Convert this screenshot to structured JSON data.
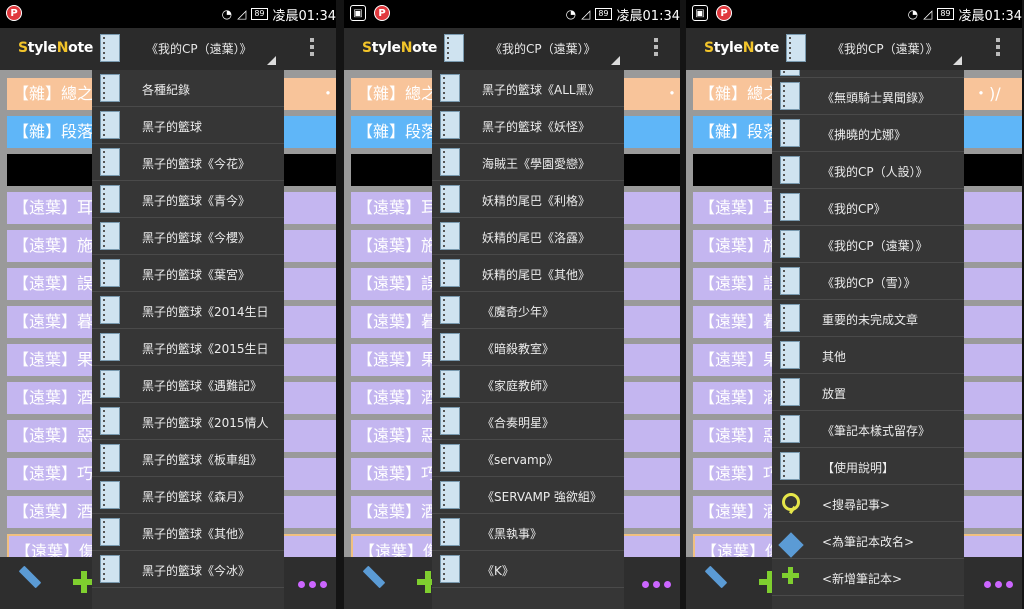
{
  "status_bar": {
    "battery": "89",
    "time": "凌晨01:34"
  },
  "app": {
    "logo_first": "S",
    "logo_mid": "tyle",
    "logo_n": "N",
    "logo_end": "ote",
    "current_notebook": "《我的CP（遠葉）》"
  },
  "colors": {
    "row_orange": "#f8c49a",
    "row_blue": "#5fb6f8",
    "row_black": "#000000",
    "row_purple": "#c4b6f0",
    "accent_green": "#7fcf2f",
    "accent_blue": "#5b9bd5",
    "accent_purple": "#cc66ff",
    "search_yellow": "#e6e64a"
  },
  "icons": [
    "photo-icon",
    "p-app-icon",
    "wifi-icon",
    "signal-icon",
    "battery-icon",
    "notebook-icon",
    "overflow-menu-icon",
    "pen-icon",
    "plus-icon",
    "more-dots-icon",
    "search-icon"
  ],
  "notes": [
    {
      "text": "【雜】總之",
      "suffix": "・)/"
    },
    {
      "text": "【雜】段落"
    },
    {
      "text": ""
    },
    {
      "text": "【遠葉】耳"
    },
    {
      "text": "【遠葉】施"
    },
    {
      "text": "【遠葉】誤"
    },
    {
      "text": "【遠葉】暮"
    },
    {
      "text": "【遠葉】果"
    },
    {
      "text": "【遠葉】酒"
    },
    {
      "text": "【遠葉】惡"
    },
    {
      "text": "【遠葉】巧"
    },
    {
      "text": "【遠葉】酒"
    },
    {
      "text": "【遠葉】傷"
    }
  ],
  "dropdown1": [
    "各種紀錄",
    "黑子的籃球",
    "黑子的籃球《今花》",
    "黑子的籃球《青今》",
    "黑子的籃球《今櫻》",
    "黑子的籃球《葉宮》",
    "黑子的籃球《2014生日",
    "黑子的籃球《2015生日",
    "黑子的籃球《遇難記》",
    "黑子的籃球《2015情人",
    "黑子的籃球《板車組》",
    "黑子的籃球《森月》",
    "黑子的籃球《其他》",
    "黑子的籃球《今冰》"
  ],
  "dropdown2": [
    "黑子的籃球《ALL黑》",
    "黑子的籃球《妖怪》",
    "海賊王《學園愛戀》",
    "妖精的尾巴《利格》",
    "妖精的尾巴《洛露》",
    "妖精的尾巴《其他》",
    "《魔奇少年》",
    "《暗殺教室》",
    "《家庭教師》",
    "《合奏明星》",
    "《servamp》",
    "《SERVAMP 強欲組》",
    "《黑執事》",
    "《K》"
  ],
  "dropdown3": [
    "《無頭騎士異聞錄》",
    "《拂曉的尤娜》",
    "《我的CP（人設）》",
    "《我的CP》",
    "《我的CP（遠葉）》",
    "《我的CP（雪）》",
    "重要的未完成文章",
    "其他",
    "放置",
    "《筆記本樣式留存》",
    "【使用說明】"
  ],
  "dropdown3_actions": [
    "<搜尋記事>",
    "<為筆記本改名>",
    "<新增筆記本>"
  ]
}
